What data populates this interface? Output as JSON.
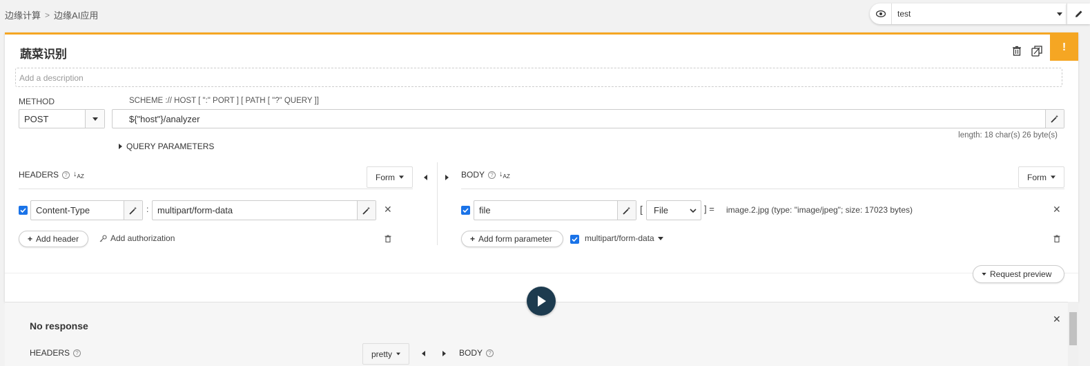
{
  "breadcrumb": [
    "边缘计算",
    "边缘AI应用"
  ],
  "environment": {
    "selected": "test"
  },
  "request": {
    "title": "蔬菜识别",
    "description_placeholder": "Add a description",
    "method_label": "METHOD",
    "method": "POST",
    "url_label": "SCHEME :// HOST [ \":\" PORT ] [ PATH [ \"?\" QUERY ]]",
    "url": "${\"host\"}/analyzer",
    "length_info": "length: 18 char(s) 26 byte(s)",
    "query_params_label": "QUERY PARAMETERS"
  },
  "headers": {
    "label": "HEADERS",
    "mode": "Form",
    "items": [
      {
        "name": "Content-Type",
        "value": "multipart/form-data",
        "enabled": true
      }
    ],
    "add_header_label": "Add header",
    "add_auth_label": "Add authorization"
  },
  "body": {
    "label": "BODY",
    "mode": "Form",
    "items": [
      {
        "name": "file",
        "type": "File",
        "value": "image.2.jpg (type: \"image/jpeg\"; size: 17023 bytes)",
        "enabled": true
      }
    ],
    "add_param_label": "Add form parameter",
    "content_type": "multipart/form-data"
  },
  "request_preview_label": "Request preview",
  "response": {
    "status": "No response",
    "headers_label": "HEADERS",
    "format": "pretty",
    "body_label": "BODY"
  },
  "colors": {
    "accent": "#f5a623",
    "checkbox": "#1a73e8",
    "play": "#1d3b4f"
  }
}
